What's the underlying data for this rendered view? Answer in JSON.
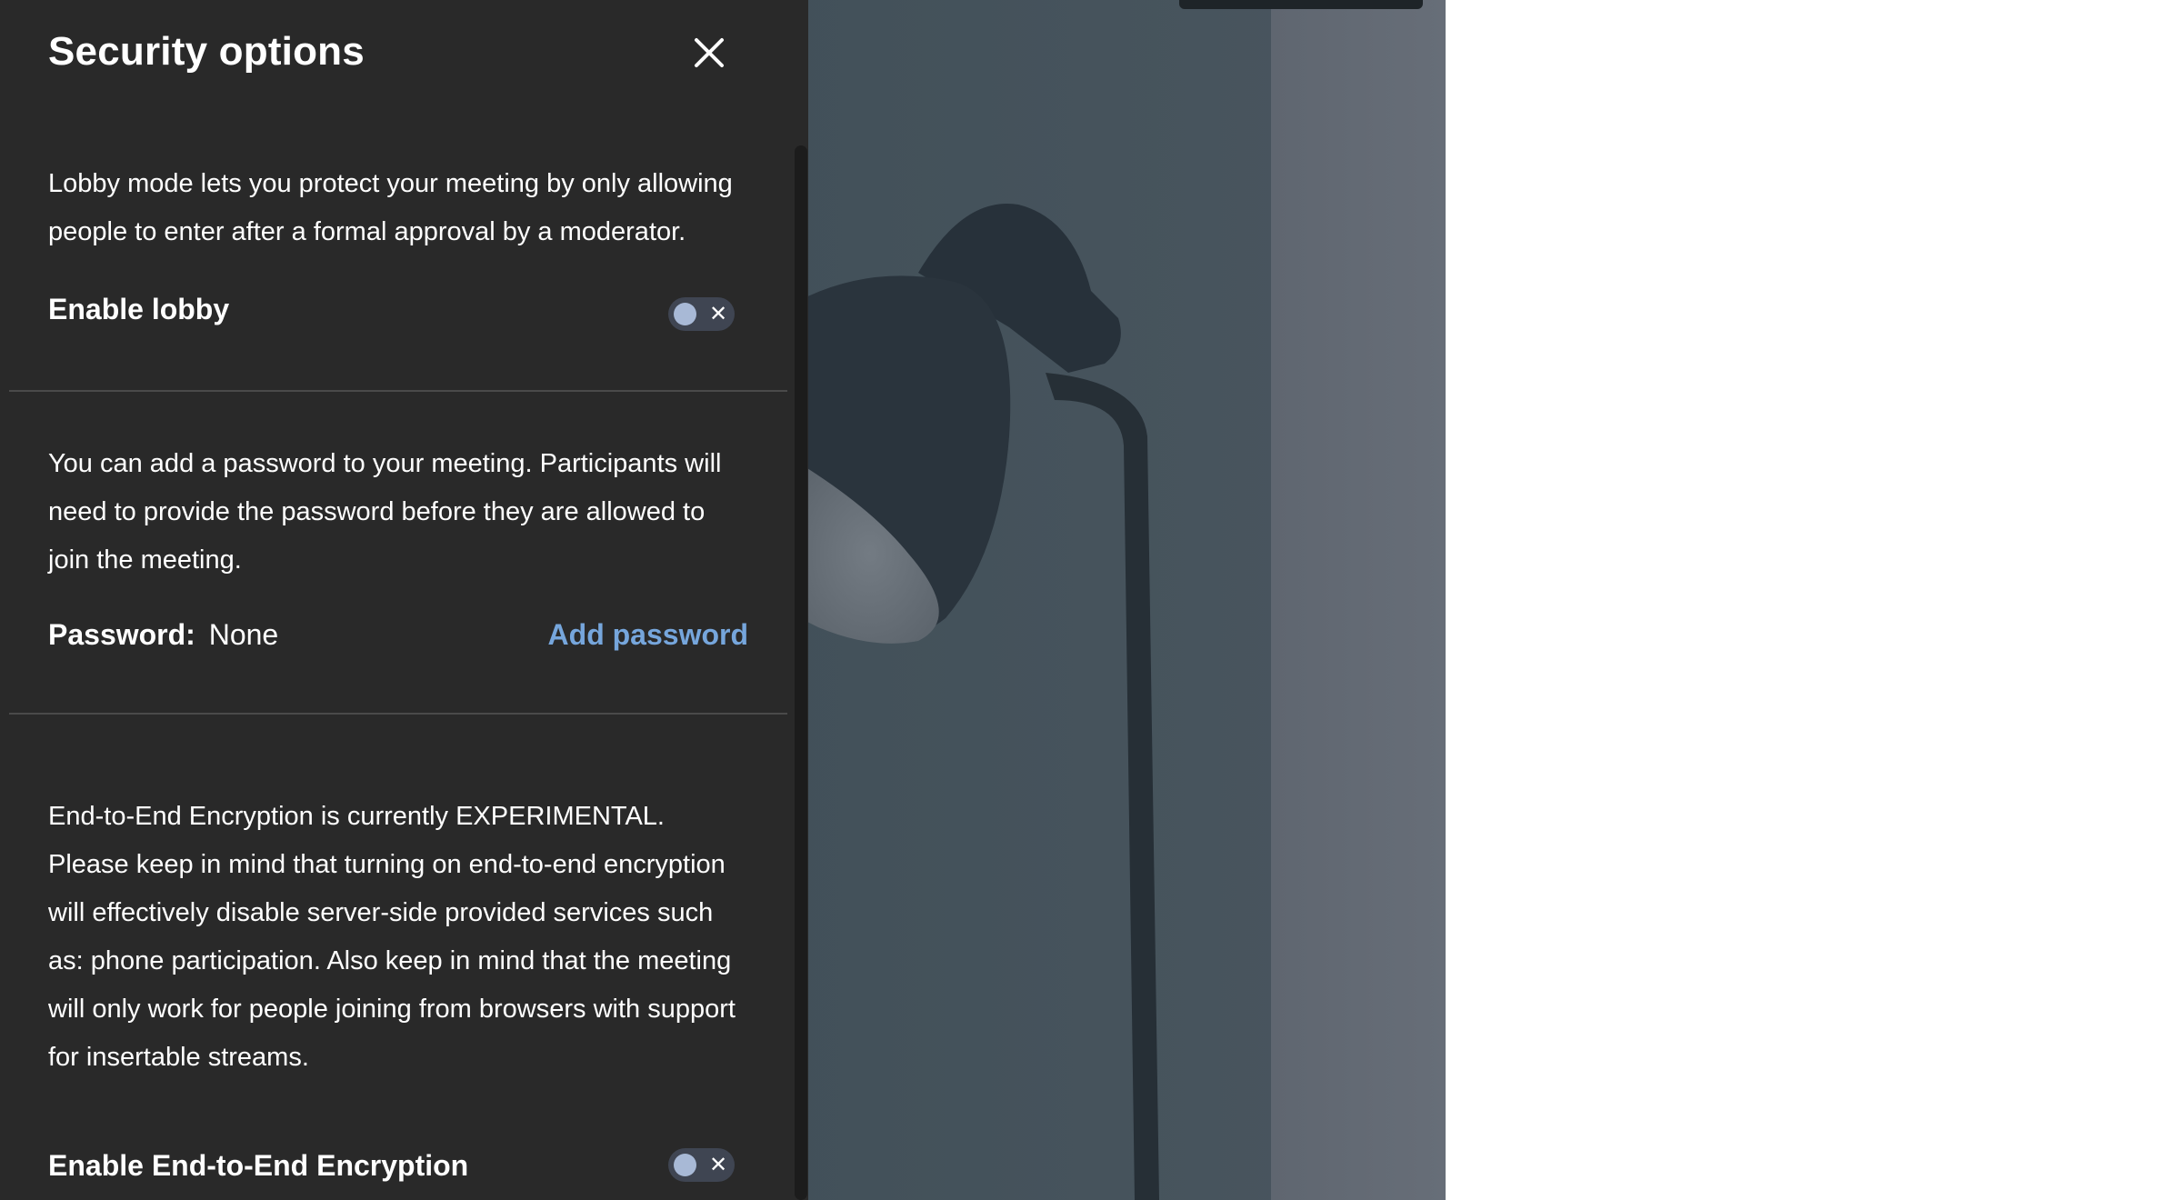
{
  "panel": {
    "title": "Security options",
    "close_icon": "close-icon"
  },
  "lobby": {
    "description": "Lobby mode lets you protect your meeting by only allowing people to enter after a formal approval by a moderator.",
    "label": "Enable lobby",
    "enabled": false,
    "toggle_icon": "x-icon"
  },
  "password": {
    "description": "You can add a password to your meeting. Participants will need to provide the password before they are allowed to join the meeting.",
    "label": "Password:",
    "value": "None",
    "action_label": "Add password"
  },
  "e2ee": {
    "description": "End-to-End Encryption is currently EXPERIMENTAL. Please keep in mind that turning on end-to-end encryption will effectively disable server-side provided services such as: phone participation. Also keep in mind that the meeting will only work for people joining from browsers with support for insertable streams.",
    "label": "Enable End-to-End Encryption",
    "enabled": false,
    "toggle_icon": "x-icon"
  },
  "colors": {
    "panel_bg": "#292929",
    "link": "#76a6dc",
    "toggle_track": "#3f4552",
    "toggle_knob": "#a8b9d6"
  }
}
